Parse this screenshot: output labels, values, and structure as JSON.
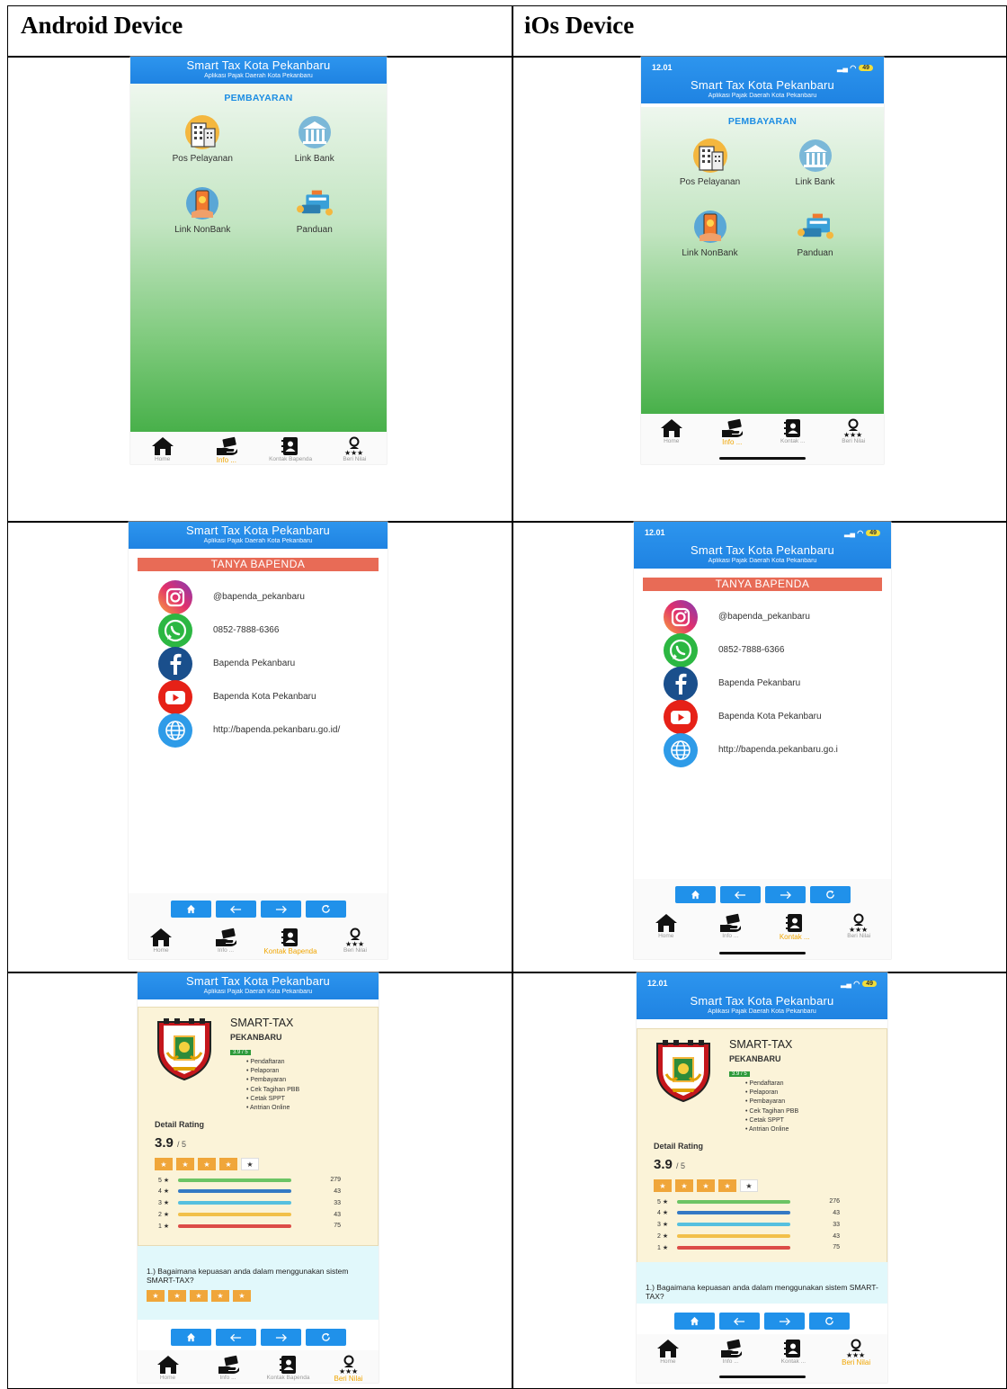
{
  "columns": {
    "android": "Android Device",
    "ios": "iOs Device"
  },
  "ios_status": {
    "time": "12.01",
    "battery": "49"
  },
  "app": {
    "title": "Smart Tax Kota Pekanbaru",
    "subtitle": "Aplikasi Pajak Daerah Kota Pekanbaru"
  },
  "payment": {
    "section": "PEMBAYARAN",
    "items": [
      {
        "label": "Pos Pelayanan",
        "icon": "building-icon"
      },
      {
        "label": "Link Bank",
        "icon": "bank-icon"
      },
      {
        "label": "Link NonBank",
        "icon": "mobile-payment-icon"
      },
      {
        "label": "Panduan",
        "icon": "payment-guide-icon"
      }
    ]
  },
  "contact": {
    "header": "TANYA BAPENDA",
    "items": [
      {
        "text": "@bapenda_pekanbaru",
        "icon": "instagram-icon"
      },
      {
        "text": "0852-7888-6366",
        "icon": "whatsapp-icon"
      },
      {
        "text": "Bapenda Pekanbaru",
        "icon": "facebook-icon"
      },
      {
        "text": "Bapenda Kota Pekanbaru",
        "icon": "youtube-icon"
      },
      {
        "text": "http://bapenda.pekanbaru.go.id/",
        "text_ios": "http://bapenda.pekanbaru.go.i",
        "icon": "globe-icon"
      }
    ]
  },
  "rating": {
    "app_name": "SMART-TAX",
    "city": "PEKANBARU",
    "badge": "3.9 / 5",
    "features": [
      "Pendaftaran",
      "Pelaporan",
      "Pembayaran",
      "Cek Tagihan PBB",
      "Cetak SPPT",
      "Antrian Online"
    ],
    "detail_label": "Detail Rating",
    "score": "3.9",
    "score_max": "/ 5",
    "stars_filled": 4,
    "distribution": [
      {
        "label": "5 ★",
        "count_android": "279",
        "count_ios": "276",
        "color": "#6cc464"
      },
      {
        "label": "4 ★",
        "count_android": "43",
        "count_ios": "43",
        "color": "#3479c4"
      },
      {
        "label": "3 ★",
        "count_android": "33",
        "count_ios": "33",
        "color": "#56c0df"
      },
      {
        "label": "2 ★",
        "count_android": "43",
        "count_ios": "43",
        "color": "#f2c04a"
      },
      {
        "label": "1 ★",
        "count_android": "75",
        "count_ios": "75",
        "color": "#dc4c47"
      }
    ],
    "question": "1.) Bagaimana kepuasan anda dalam menggunakan sistem SMART-TAX?"
  },
  "nav": {
    "android_full": [
      "Home",
      "Info ...",
      "Kontak Bapenda",
      "Beri Nilai"
    ],
    "ios_short": [
      "Home",
      "Info ...",
      "Kontak ...",
      "Beri Nilai"
    ]
  },
  "star_glyph": "★",
  "colors": {
    "primary": "#1f83e2",
    "accent": "#f0a500",
    "tanya": "#e86b56"
  }
}
